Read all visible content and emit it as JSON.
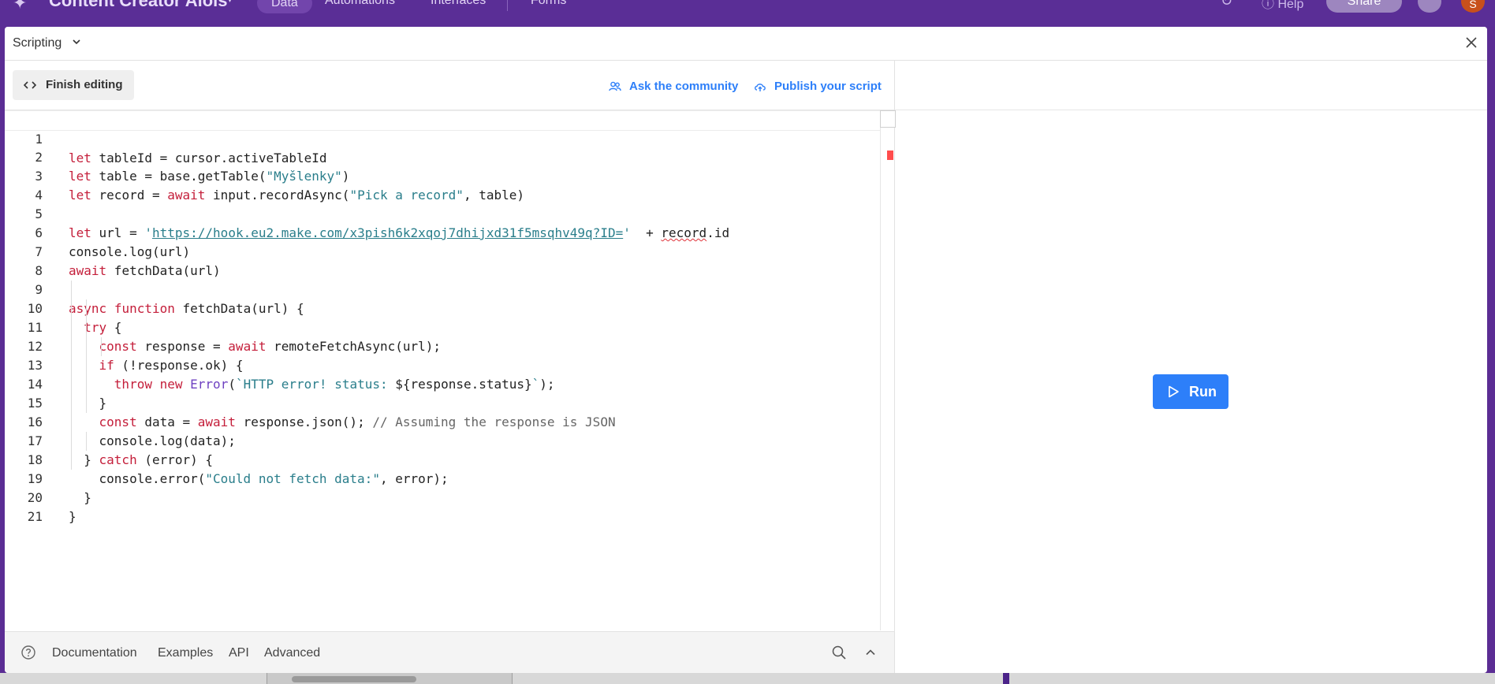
{
  "background": {
    "base_name": "Content Creator Alois",
    "tabs": [
      "Data",
      "Automations",
      "Interfaces",
      "Forms"
    ],
    "help_label": "Help",
    "share_label": "Share",
    "avatar_initial": "S"
  },
  "modal": {
    "title": "Scripting"
  },
  "toolbar": {
    "finish_editing": "Finish editing",
    "ask_community": "Ask the community",
    "publish_script": "Publish your script"
  },
  "code": {
    "line_numbers": [
      "1",
      "2",
      "3",
      "4",
      "5",
      "6",
      "7",
      "8",
      "9",
      "10",
      "11",
      "12",
      "13",
      "14",
      "15",
      "16",
      "17",
      "18",
      "19",
      "20",
      "21"
    ],
    "lines": [
      "let tableId = cursor.activeTableId",
      "let table = base.getTable(\"Myšlenky\")",
      "let record = await input.recordAsync(\"Pick a record\", table)",
      "",
      "let url = 'https://hook.eu2.make.com/x3pish6k2xqoj7dhijxd31f5msqhv49q?ID='  + record.id",
      "console.log(url)",
      "await fetchData(url)",
      "",
      "async function fetchData(url) {",
      "  try {",
      "    const response = await remoteFetchAsync(url);",
      "    if (!response.ok) {",
      "      throw new Error(`HTTP error! status: ${response.status}`);",
      "    }",
      "    const data = await response.json(); // Assuming the response is JSON",
      "    console.log(data);",
      "  } catch (error) {",
      "    console.error(\"Could not fetch data:\", error);",
      "  }",
      "}",
      ""
    ]
  },
  "footer": {
    "documentation": "Documentation",
    "examples": "Examples",
    "api": "API",
    "advanced": "Advanced"
  },
  "run": {
    "label": "Run"
  },
  "colors": {
    "accent": "#2d7ff9",
    "keyword": "#c41e3a",
    "string": "#2a7e8b",
    "app_bar": "#5a2e96"
  }
}
